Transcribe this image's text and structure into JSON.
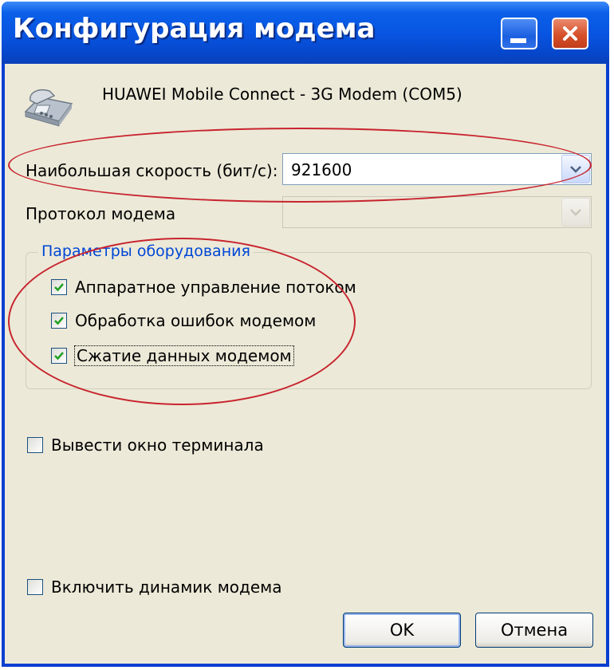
{
  "window": {
    "title": "Конфигурация модема",
    "icons": {
      "minimize": "minimize-icon",
      "close": "close-icon"
    }
  },
  "device": {
    "icon": "modem-phone-icon",
    "name": "HUAWEI Mobile Connect - 3G Modem (COM5)"
  },
  "speed": {
    "label": "Наибольшая скорость (бит/с):",
    "value": "921600"
  },
  "protocol": {
    "label": "Протокол модема",
    "value": ""
  },
  "hardware": {
    "legend": "Параметры оборудования",
    "options": [
      {
        "label": "Аппаратное управление потоком",
        "checked": true
      },
      {
        "label": "Обработка ошибок модемом",
        "checked": true
      },
      {
        "label": "Сжатие данных модемом",
        "checked": true
      }
    ]
  },
  "terminal": {
    "label": "Вывести окно терминала",
    "checked": false
  },
  "speaker": {
    "label": "Включить динамик модема",
    "checked": false
  },
  "buttons": {
    "ok": "OK",
    "cancel": "Отмена"
  },
  "colors": {
    "titlebar": "#0854e0",
    "dialog": "#ece9d8",
    "highlight_ring": "#c8242e",
    "group_legend": "#0046d5"
  }
}
